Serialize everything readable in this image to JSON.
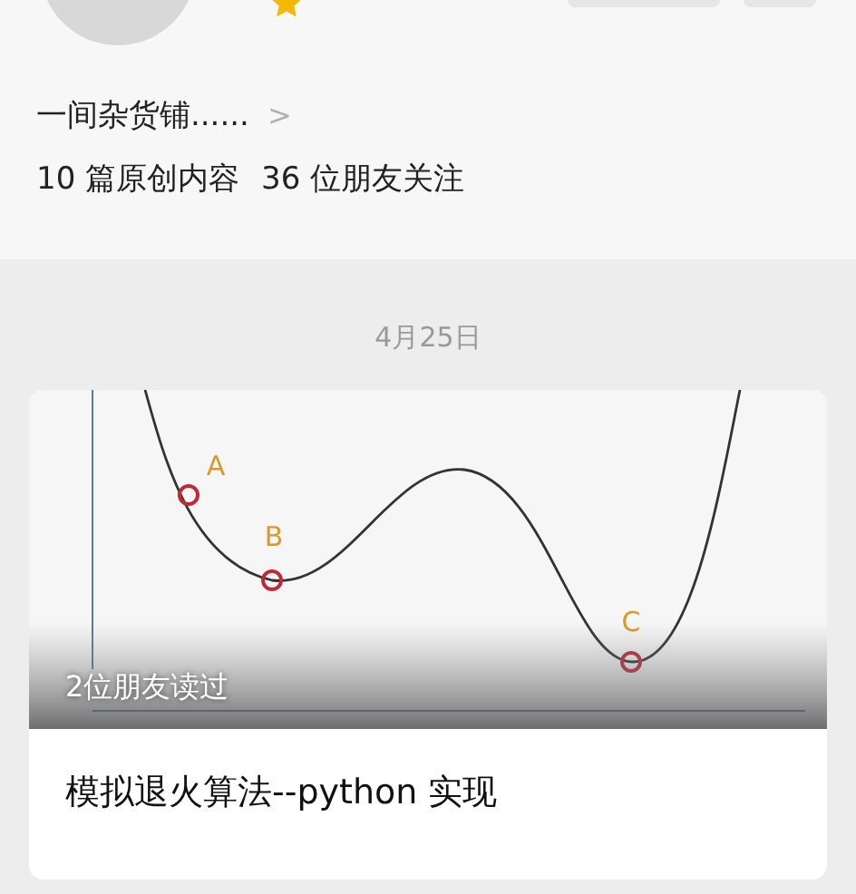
{
  "profile": {
    "rated": true,
    "bio": "一间杂货铺......",
    "chevron": ">",
    "stats": [
      "10 篇原创内容",
      "36 位朋友关注"
    ]
  },
  "feed": {
    "date": "4月25日",
    "articles": [
      {
        "kind": "picture-card",
        "points": [
          "A",
          "B",
          "C"
        ],
        "read_by": "2位朋友读过",
        "title": "模拟退火算法--python 实现"
      }
    ]
  }
}
